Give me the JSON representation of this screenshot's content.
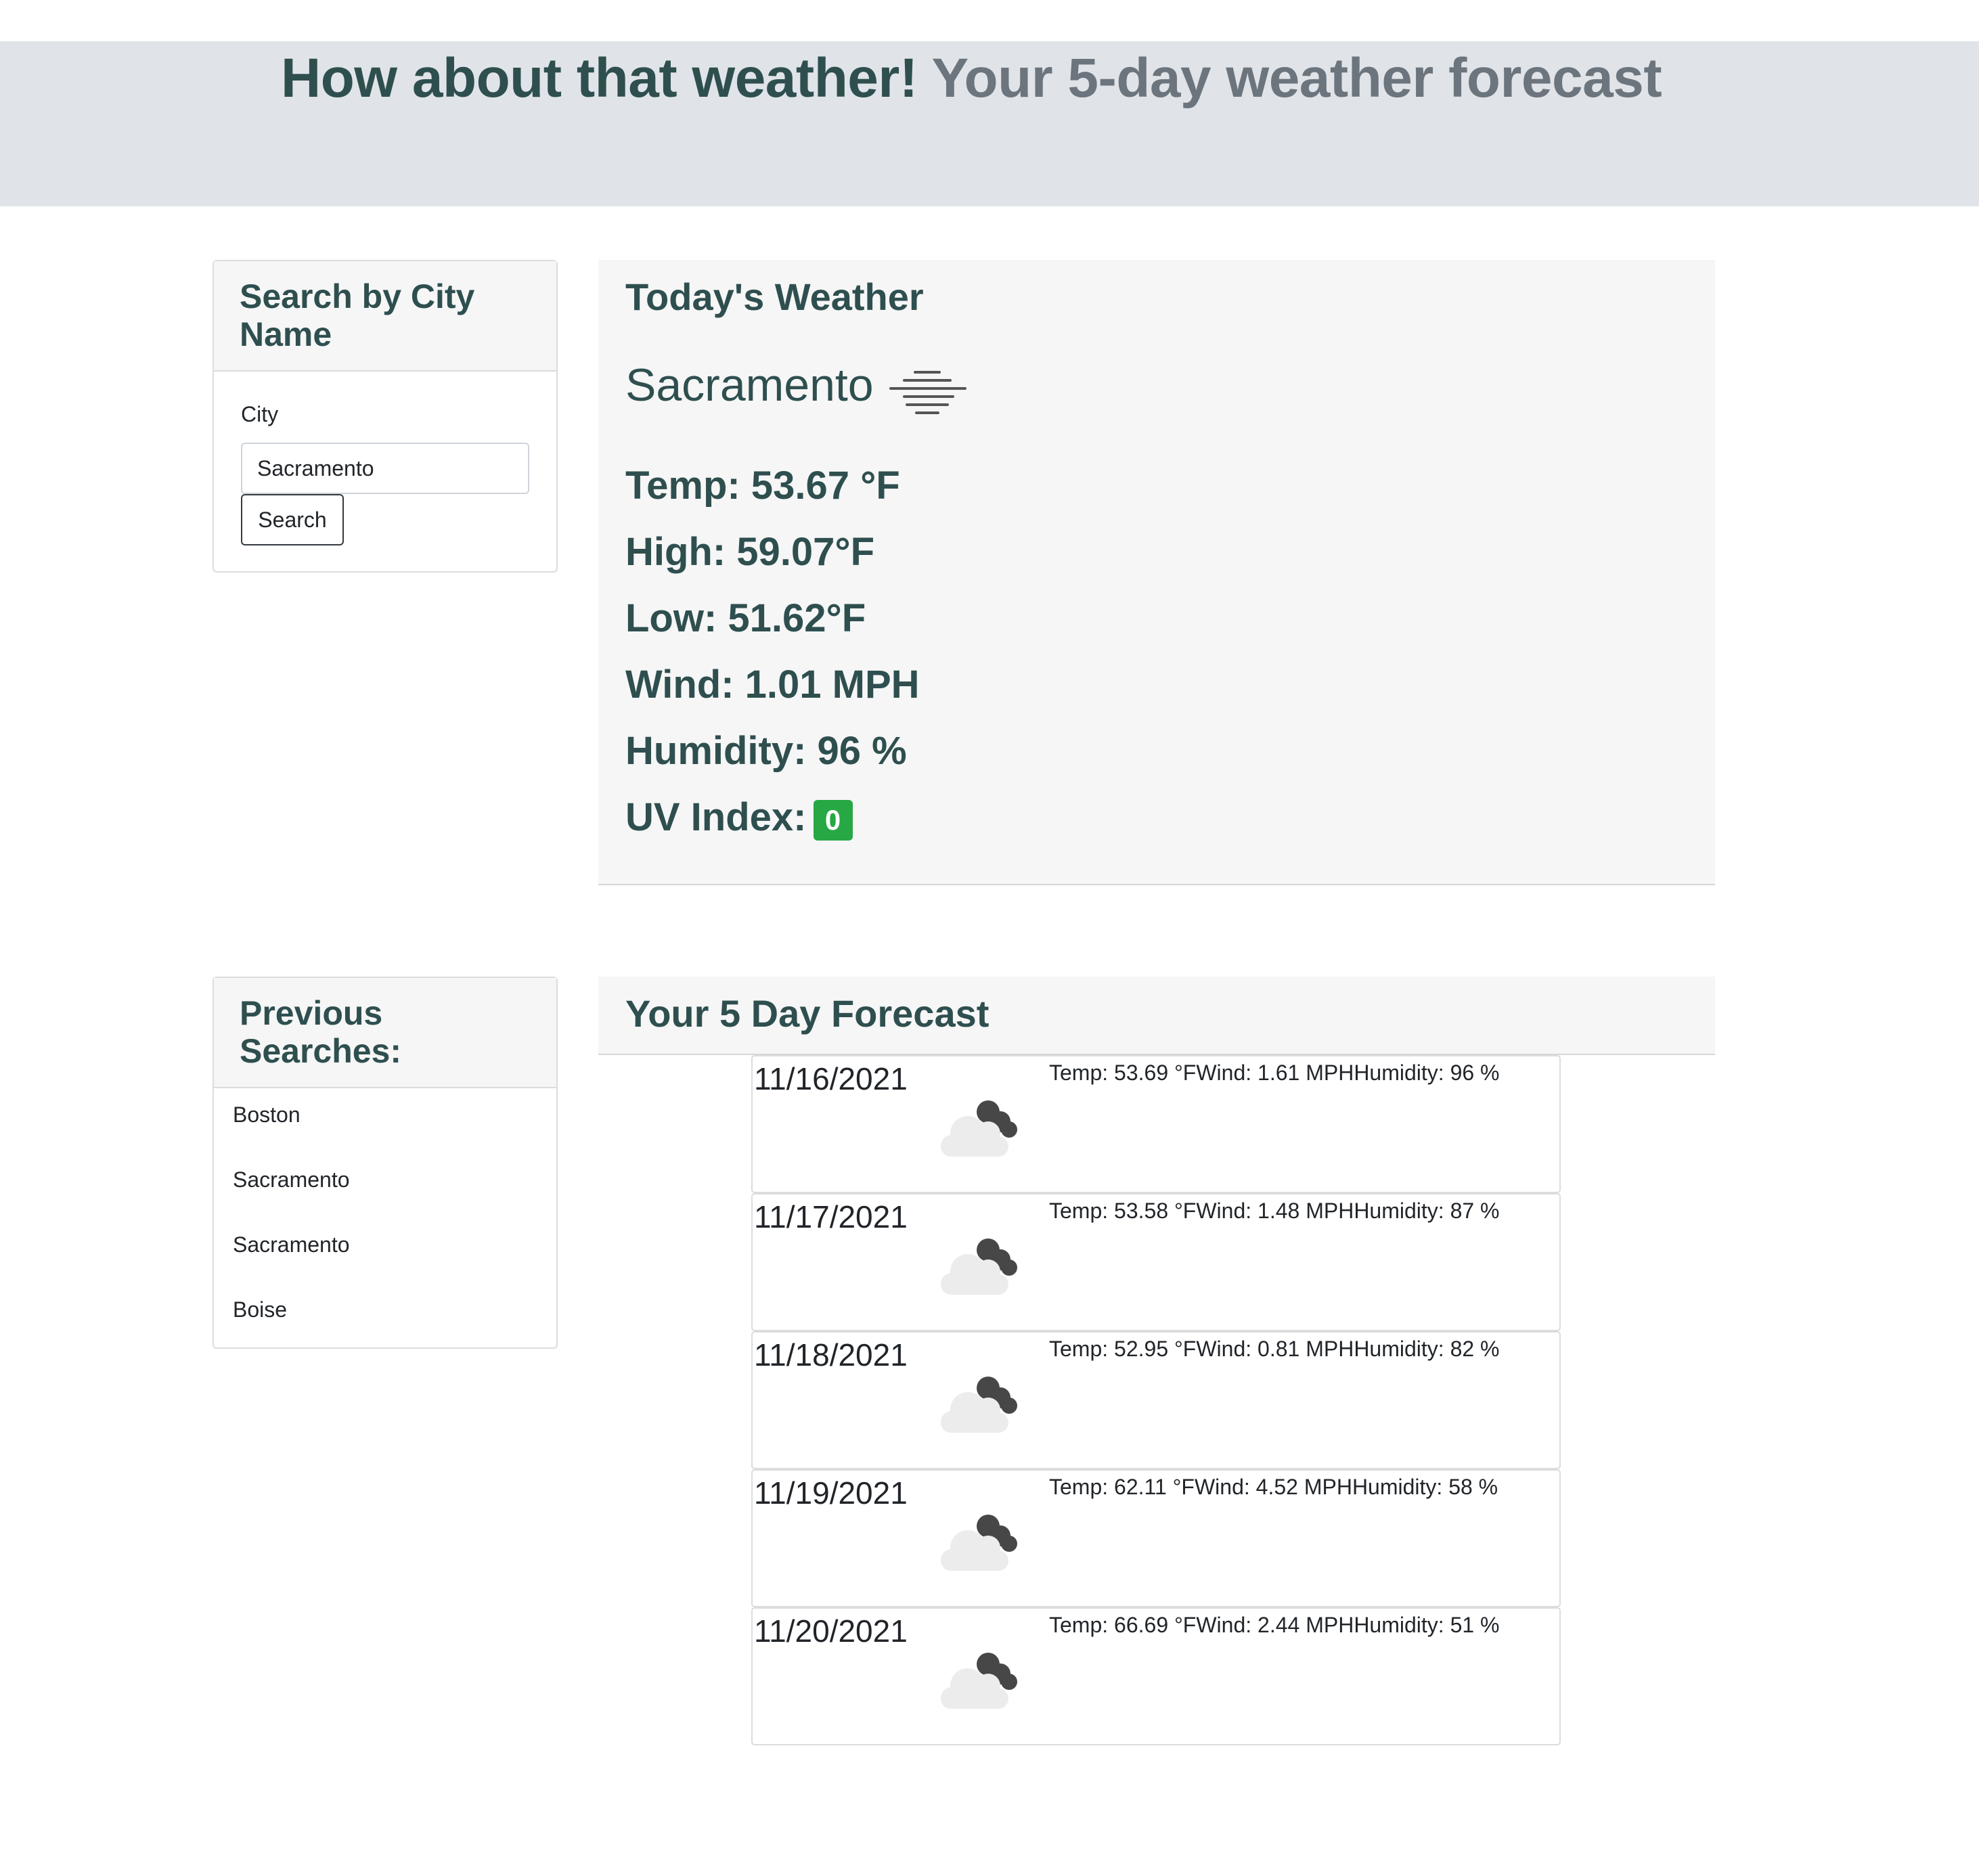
{
  "header": {
    "title": "How about that weather!",
    "subtitle": "Your 5-day weather forecast"
  },
  "search": {
    "title": "Search by City Name",
    "city_label": "City",
    "city_value": "Sacramento",
    "button_label": "Search"
  },
  "today": {
    "title": "Today's Weather",
    "city": "Sacramento",
    "icon": "mist-icon",
    "temp": "Temp: 53.67 °F",
    "high": "High: 59.07°F",
    "low": "Low: 51.62°F",
    "wind": "Wind: 1.01 MPH",
    "humidity": "Humidity: 96 %",
    "uv_label": "UV Index:",
    "uv_value": "0",
    "uv_color": "#28a745"
  },
  "history": {
    "title": "Previous Searches:",
    "items": [
      {
        "label": "Boston"
      },
      {
        "label": "Sacramento"
      },
      {
        "label": "Sacramento"
      },
      {
        "label": "Boise"
      }
    ]
  },
  "forecast": {
    "title": "Your 5 Day Forecast",
    "icon": "broken-clouds-icon",
    "days": [
      {
        "date": "11/16/2021",
        "temp": "Temp: 53.69 °F",
        "wind": "Wind: 1.61 MPH",
        "humidity": "Humidity: 96 %"
      },
      {
        "date": "11/17/2021",
        "temp": "Temp: 53.58 °F",
        "wind": "Wind: 1.48 MPH",
        "humidity": "Humidity: 87 %"
      },
      {
        "date": "11/18/2021",
        "temp": "Temp: 52.95 °F",
        "wind": "Wind: 0.81 MPH",
        "humidity": "Humidity: 82 %"
      },
      {
        "date": "11/19/2021",
        "temp": "Temp: 62.11 °F",
        "wind": "Wind: 4.52 MPH",
        "humidity": "Humidity: 58 %"
      },
      {
        "date": "11/20/2021",
        "temp": "Temp: 66.69 °F",
        "wind": "Wind: 2.44 MPH",
        "humidity": "Humidity: 51 %"
      }
    ]
  },
  "colors": {
    "heading": "#2f4f4f",
    "subtitle": "#6c757d",
    "jumbotron_bg": "#e0e4e8",
    "panel_bg": "#f6f6f6"
  }
}
